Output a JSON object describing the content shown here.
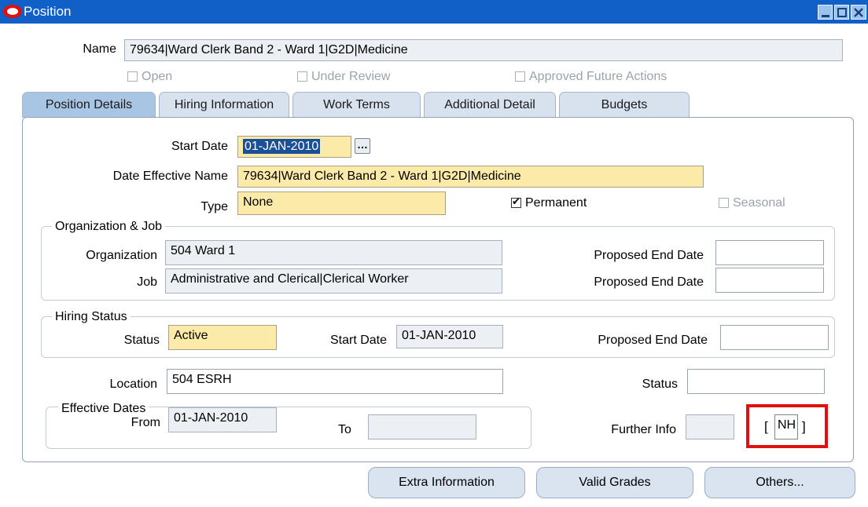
{
  "window": {
    "title": "Position"
  },
  "header": {
    "name_label": "Name",
    "name_value": "79634|Ward Clerk Band 2 - Ward 1|G2D|Medicine",
    "checkboxes": [
      {
        "label": "Open",
        "checked": false
      },
      {
        "label": "Under Review",
        "checked": false
      },
      {
        "label": "Approved Future Actions",
        "checked": false
      }
    ]
  },
  "tabs": [
    {
      "label": "Position Details",
      "active": true
    },
    {
      "label": "Hiring Information",
      "active": false
    },
    {
      "label": "Work Terms",
      "active": false
    },
    {
      "label": "Additional Detail",
      "active": false
    },
    {
      "label": "Budgets",
      "active": false
    }
  ],
  "details": {
    "start_date_label": "Start Date",
    "start_date_value": "01-JAN-2010",
    "date_effective_name_label": "Date Effective Name",
    "date_effective_name_value": "79634|Ward Clerk Band 2 - Ward 1|G2D|Medicine",
    "type_label": "Type",
    "type_value": "None",
    "permanent_label": "Permanent",
    "permanent_checked": true,
    "seasonal_label": "Seasonal",
    "seasonal_checked": false
  },
  "org_job": {
    "title": "Organization & Job",
    "organization_label": "Organization",
    "organization_value": "504 Ward 1",
    "job_label": "Job",
    "job_value": "Administrative and Clerical|Clerical Worker",
    "proposed_end_date_label_1": "Proposed End Date",
    "proposed_end_date_value_1": "",
    "proposed_end_date_label_2": "Proposed End Date",
    "proposed_end_date_value_2": ""
  },
  "hiring_status": {
    "title": "Hiring Status",
    "status_label": "Status",
    "status_value": "Active",
    "start_date_label": "Start Date",
    "start_date_value": "01-JAN-2010",
    "proposed_end_date_label": "Proposed End Date",
    "proposed_end_date_value": ""
  },
  "location": {
    "location_label": "Location",
    "location_value": "504 ESRH",
    "status_label": "Status",
    "status_value": ""
  },
  "effective_dates": {
    "title": "Effective Dates",
    "from_label": "From",
    "from_value": "01-JAN-2010",
    "to_label": "To",
    "to_value": ""
  },
  "further_info": {
    "label": "Further Info",
    "value": "",
    "dff_open": "[",
    "dff_value": "NH",
    "dff_close": "]",
    "highlight_color": "#e01010"
  },
  "buttons": {
    "extra_information": "Extra Information",
    "valid_grades": "Valid Grades",
    "others": "Others..."
  },
  "colors": {
    "title_bar": "#1060c8",
    "required_field": "#fceba8",
    "active_tab": "#a9c5e4"
  }
}
